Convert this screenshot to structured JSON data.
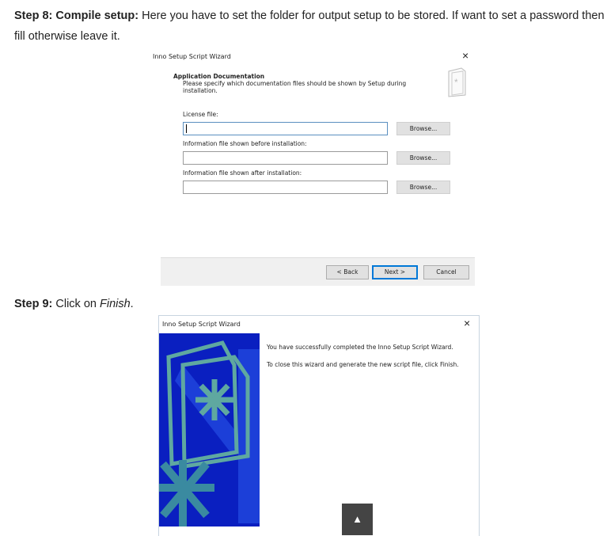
{
  "step8": {
    "bold": "Step 8: Compile setup:",
    "text": " Here you have to set the folder for output setup to be stored. If want to set a password then fill otherwise leave it."
  },
  "dialog1": {
    "title": "Inno Setup Script Wizard",
    "close": "×",
    "heading": "Application Documentation",
    "description": "Please specify which documentation files should be shown by Setup during installation.",
    "fields": [
      {
        "label": "License file:",
        "value": "",
        "browse": "Browse..."
      },
      {
        "label": "Information file shown before installation:",
        "value": "",
        "browse": "Browse..."
      },
      {
        "label": "Information file shown after installation:",
        "value": "",
        "browse": "Browse..."
      }
    ],
    "back": "< Back",
    "next": "Next >",
    "cancel": "Cancel"
  },
  "step9": {
    "bold": "Step 9:",
    "text": " Click on ",
    "em": "Finish",
    "end": "."
  },
  "dialog2": {
    "title": "Inno Setup Script Wizard",
    "close": "×",
    "line1": "You have successfully completed the Inno Setup Script Wizard.",
    "line2": "To close this wizard and generate the new script file, click Finish."
  },
  "scroll_top": "▲",
  "colors": {
    "wizard_blue": "#0a1fc0",
    "wizard_teal": "#5fa8a0",
    "footer": "#f0f0f0",
    "next_border": "#0078d7"
  }
}
